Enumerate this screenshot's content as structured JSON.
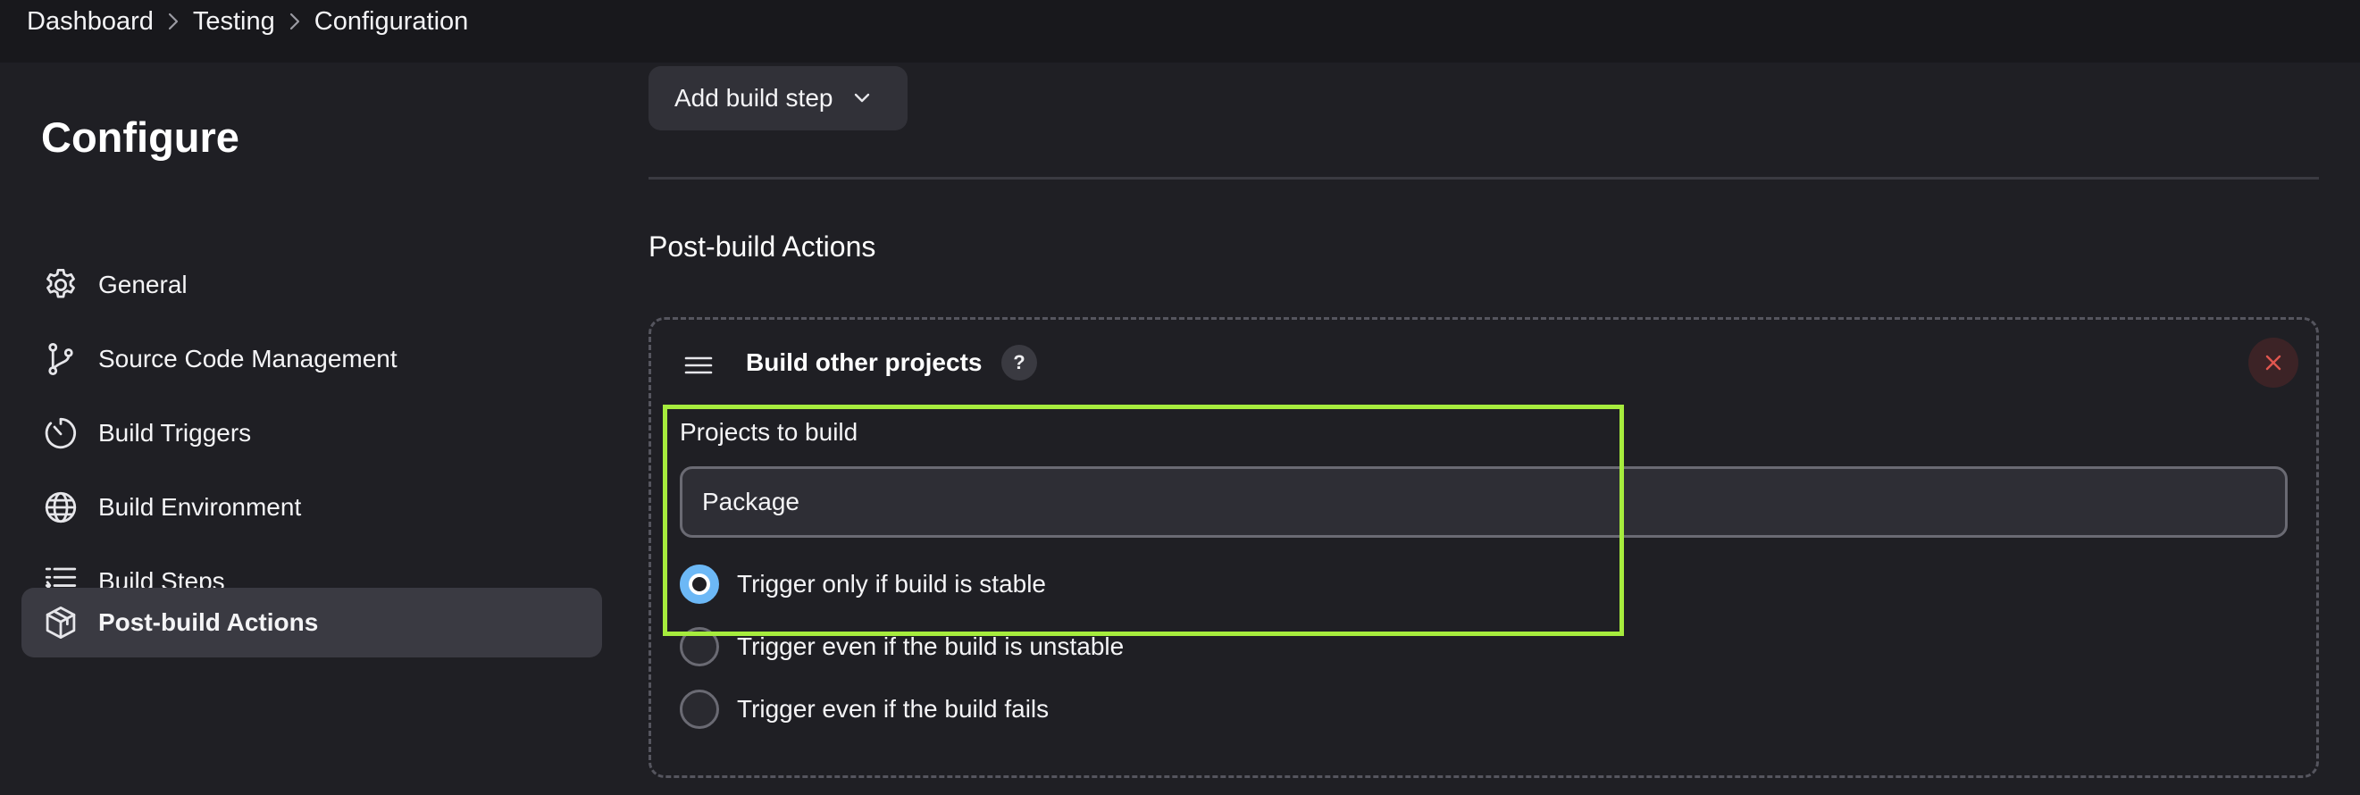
{
  "breadcrumb": {
    "items": [
      "Dashboard",
      "Testing",
      "Configuration"
    ]
  },
  "sidebar": {
    "title": "Configure",
    "items": [
      {
        "label": "General",
        "icon": "gear-icon"
      },
      {
        "label": "Source Code Management",
        "icon": "branch-icon"
      },
      {
        "label": "Build Triggers",
        "icon": "timer-icon"
      },
      {
        "label": "Build Environment",
        "icon": "globe-icon"
      },
      {
        "label": "Build Steps",
        "icon": "list-icon"
      },
      {
        "label": "Post-build Actions",
        "icon": "package-icon",
        "active": true
      }
    ]
  },
  "main": {
    "add_step_label": "Add build step",
    "section_title": "Post-build Actions",
    "card": {
      "title": "Build other projects",
      "help_label": "?",
      "field_label": "Projects to build",
      "field_value": "Package",
      "radios": [
        {
          "label": "Trigger only if build is stable",
          "checked": true
        },
        {
          "label": "Trigger even if the build is unstable",
          "checked": false
        },
        {
          "label": "Trigger even if the build fails",
          "checked": false
        }
      ]
    }
  },
  "colors": {
    "background": "#1f1f24",
    "topbar": "#18181c",
    "active_item": "#3a3a42",
    "radio_checked": "#6cb8f6",
    "highlight": "#a6ec3d",
    "close_icon": "#e0564f"
  }
}
